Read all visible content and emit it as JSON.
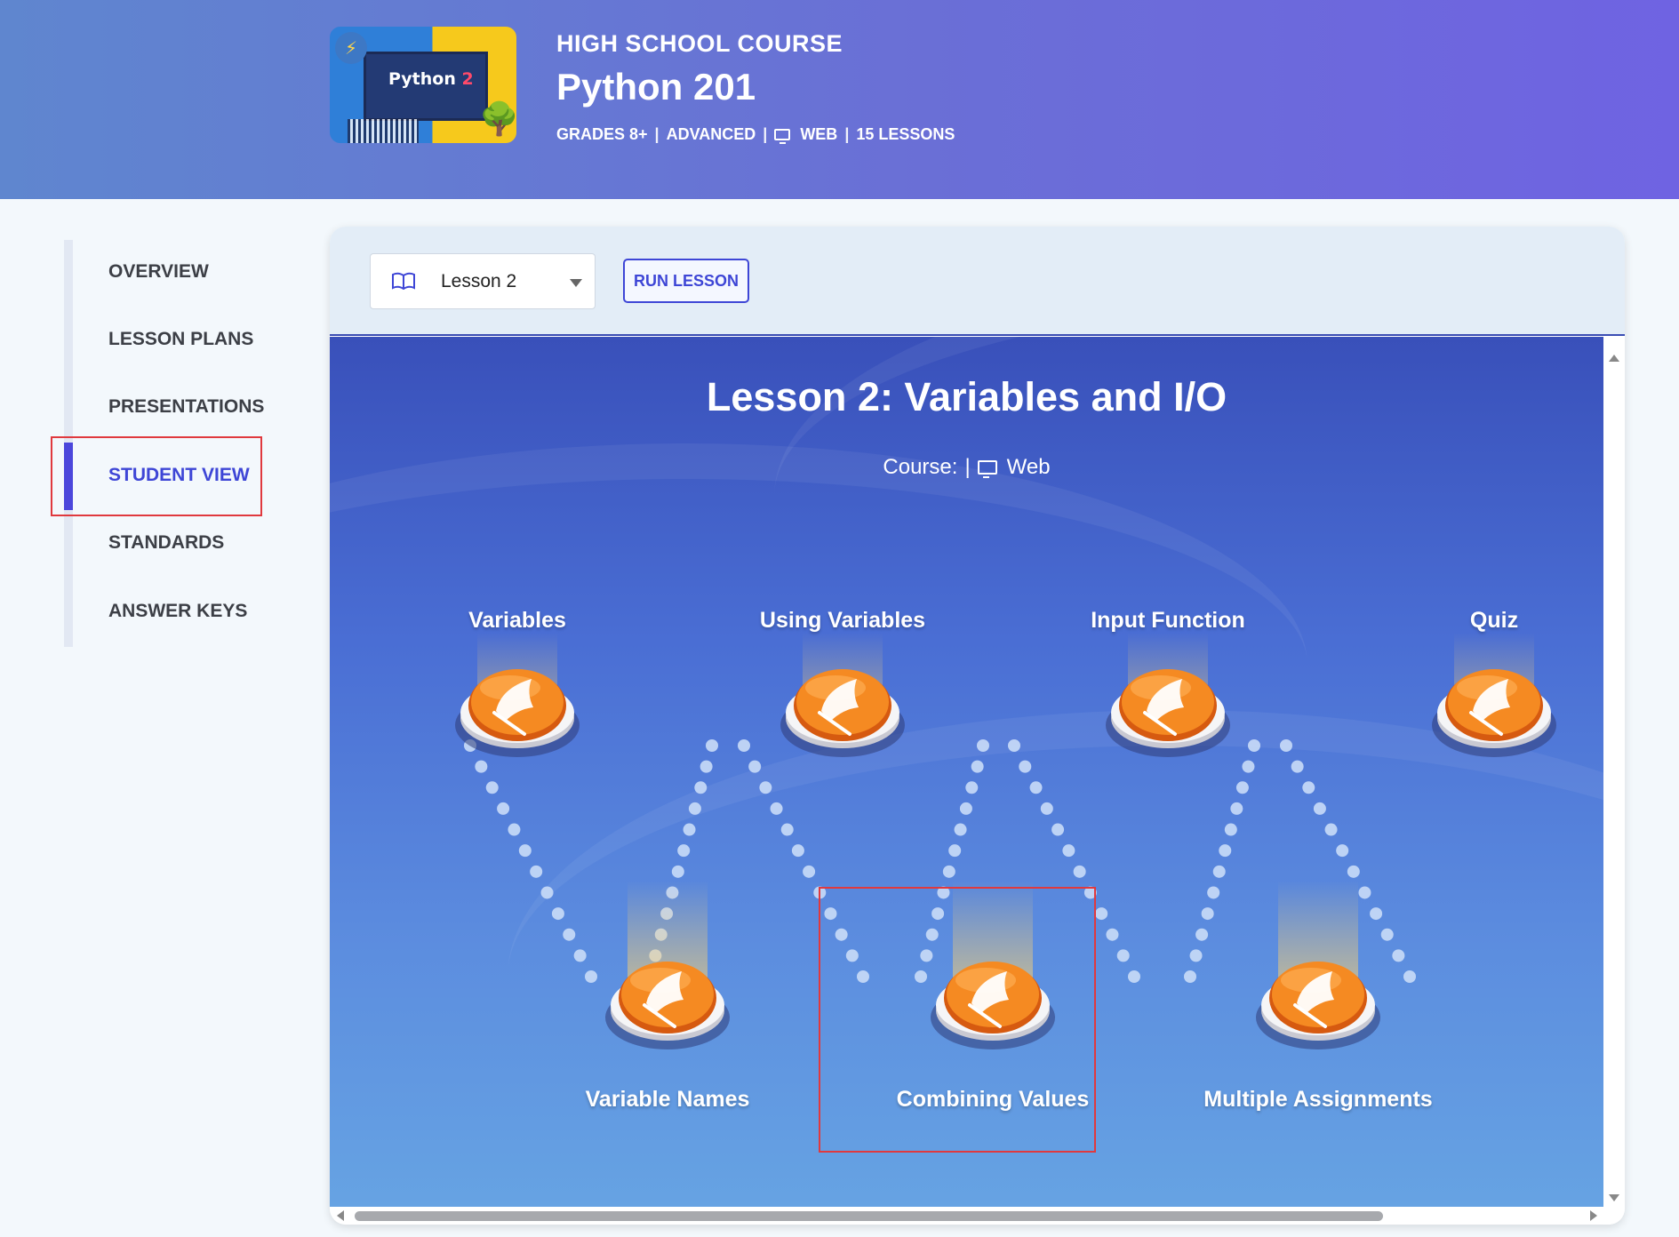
{
  "header": {
    "kicker": "HIGH SCHOOL COURSE",
    "title": "Python 201",
    "thumbnail_text": "Python",
    "thumbnail_badge": "2",
    "meta": {
      "grades": "GRADES 8+",
      "level": "ADVANCED",
      "platform": "WEB",
      "lessons": "15 LESSONS"
    }
  },
  "sidebar": {
    "items": [
      {
        "label": "OVERVIEW"
      },
      {
        "label": "LESSON PLANS"
      },
      {
        "label": "PRESENTATIONS"
      },
      {
        "label": "STUDENT VIEW",
        "active": true
      },
      {
        "label": "STANDARDS"
      },
      {
        "label": "ANSWER KEYS"
      }
    ]
  },
  "toolbar": {
    "lesson_select": "Lesson 2",
    "run_label": "RUN LESSON"
  },
  "stage": {
    "title": "Lesson 2: Variables and I/O",
    "course_label": "Course:",
    "separator": "|",
    "platform": "Web",
    "nodes": [
      {
        "label": "Variables"
      },
      {
        "label": "Using Variables"
      },
      {
        "label": "Input Function"
      },
      {
        "label": "Quiz"
      },
      {
        "label": "Variable Names"
      },
      {
        "label": "Combining Values"
      },
      {
        "label": "Multiple Assignments"
      }
    ]
  },
  "colors": {
    "accent": "#3e46d6",
    "highlight": "#e0393e",
    "node_orange": "#f27a1a"
  }
}
